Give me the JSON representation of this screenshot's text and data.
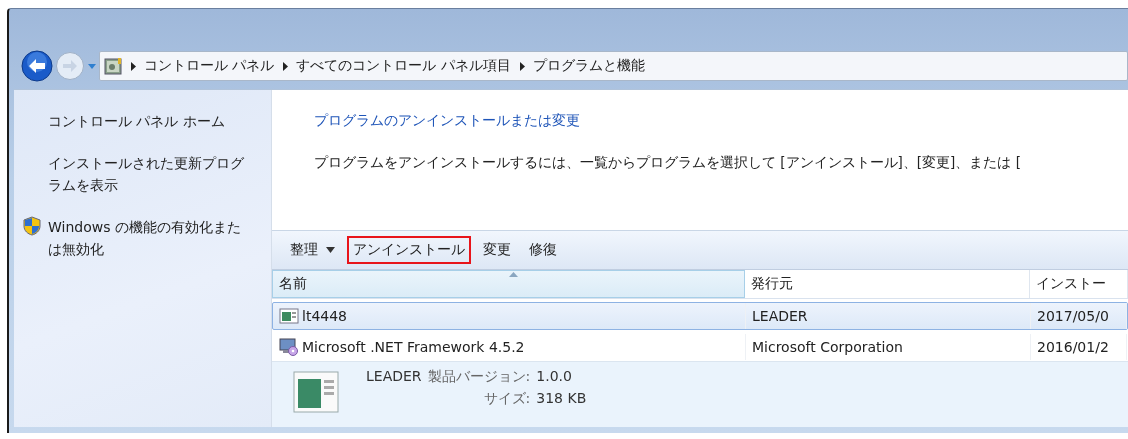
{
  "address_bar": {
    "segments": [
      "コントロール パネル",
      "すべてのコントロール パネル項目",
      "プログラムと機能"
    ]
  },
  "sidebar": {
    "items": [
      {
        "label": "コントロール パネル ホーム",
        "kind": "link"
      },
      {
        "label": "インストールされた更新プログラムを表示",
        "kind": "link"
      },
      {
        "label": "Windows の機能の有効化または無効化",
        "kind": "shield"
      }
    ]
  },
  "main": {
    "title": "プログラムのアンインストールまたは変更",
    "description": "プログラムをアンインストールするには、一覧からプログラムを選択して [アンインストール]、[変更]、または ["
  },
  "toolbar": [
    {
      "label": "整理",
      "kind": "menu",
      "highlighted": false
    },
    {
      "label": "アンインストール",
      "kind": "button",
      "highlighted": true
    },
    {
      "label": "変更",
      "kind": "button",
      "highlighted": false
    },
    {
      "label": "修復",
      "kind": "button",
      "highlighted": false
    }
  ],
  "table": {
    "columns": [
      {
        "label": "名前",
        "sorted": true
      },
      {
        "label": "発行元",
        "sorted": false
      },
      {
        "label": "インストー",
        "sorted": false
      }
    ],
    "rows": [
      {
        "kind": "app",
        "selected": true,
        "cells": [
          "lt4448",
          "LEADER",
          "2017/05/0"
        ]
      },
      {
        "kind": "installer",
        "selected": false,
        "cells": [
          "Microsoft .NET Framework 4.5.2",
          "Microsoft Corporation",
          "2016/01/2"
        ]
      }
    ]
  },
  "details": {
    "publisher": "LEADER",
    "version_label": "製品バージョン:",
    "version": "1.0.0",
    "size_label": "サイズ:",
    "size": "318 KB"
  }
}
